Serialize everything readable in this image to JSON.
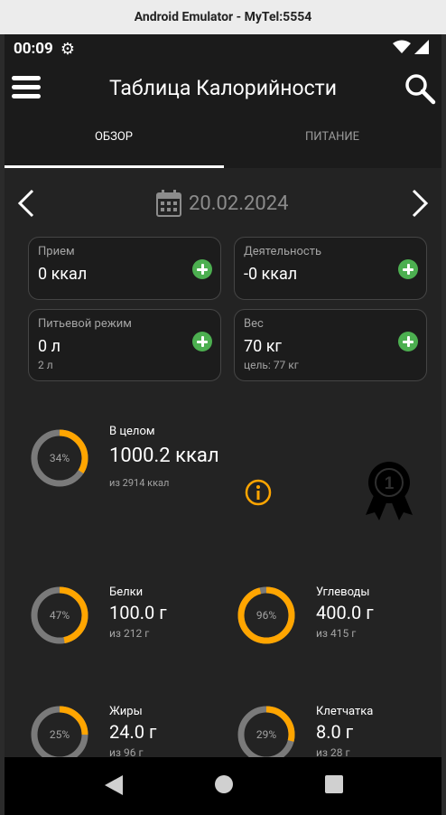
{
  "window": {
    "title": "Android Emulator - MyTel:5554"
  },
  "status_bar": {
    "time": "00:09"
  },
  "app": {
    "title": "Таблица Калорийности"
  },
  "tabs": [
    {
      "label": "ОБЗОР",
      "active": true
    },
    {
      "label": "ПИТАНИЕ",
      "active": false
    }
  ],
  "date": {
    "value": "20.02.2024"
  },
  "cards": {
    "intake": {
      "label": "Прием",
      "value": "0 ккал"
    },
    "activity": {
      "label": "Деятельность",
      "value": "-0 ккал"
    },
    "water": {
      "label": "Питьевой режим",
      "value": "0 л",
      "sub": "2 л"
    },
    "weight": {
      "label": "Вес",
      "value": "70 кг",
      "sub": "цель: 77 кг"
    }
  },
  "summary": {
    "total": {
      "label": "В целом",
      "value": "1000.2 ккал",
      "sub": "из 2914 ккал",
      "percent_text": "34%",
      "fraction": 0.34
    },
    "protein": {
      "label": "Белки",
      "value": "100.0 г",
      "sub": "из 212 г",
      "percent_text": "47%",
      "fraction": 0.47
    },
    "carbs": {
      "label": "Углеводы",
      "value": "400.0 г",
      "sub": "из 415 г",
      "percent_text": "96%",
      "fraction": 0.96
    },
    "fat": {
      "label": "Жиры",
      "value": "24.0 г",
      "sub": "из 96 г",
      "percent_text": "25%",
      "fraction": 0.25
    },
    "fiber": {
      "label": "Клетчатка",
      "value": "8.0 г",
      "sub": "из 28 г",
      "percent_text": "29%",
      "fraction": 0.29
    }
  },
  "colors": {
    "accent": "#ffa500",
    "ring_track": "#7a7a7a",
    "add_button": "#4caf50",
    "background": "#232323",
    "card_background": "#1c1c1c"
  },
  "icons": {
    "menu": "hamburger-menu-icon",
    "search": "search-icon",
    "calendar": "calendar-icon",
    "prev": "chevron-left-icon",
    "next": "chevron-right-icon",
    "add": "plus-circle-icon",
    "info": "info-icon",
    "medal": "medal-icon"
  }
}
